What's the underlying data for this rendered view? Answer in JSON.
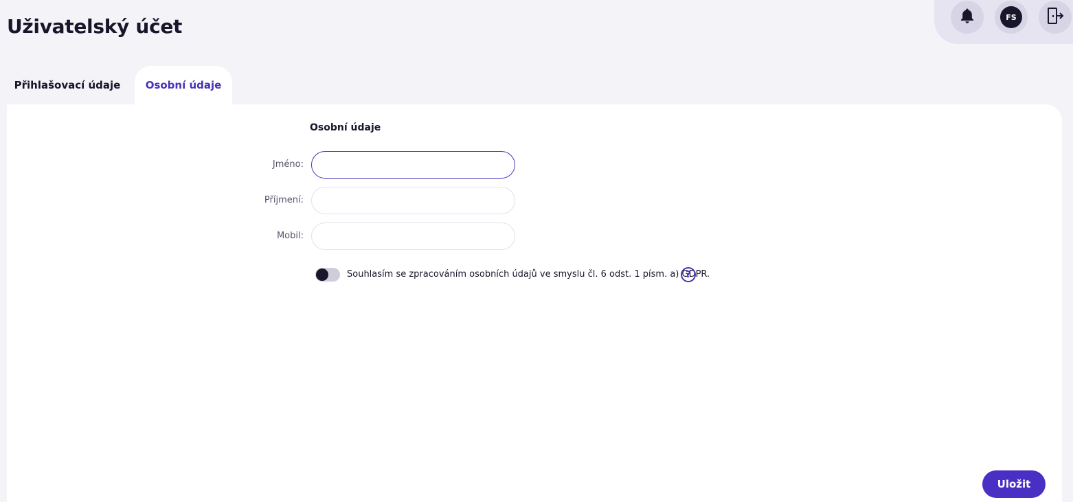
{
  "page": {
    "title": "Uživatelský účet"
  },
  "topbar": {
    "bell_icon": "bell-icon",
    "avatar_initials": "FS",
    "logout_icon": "logout-door-icon"
  },
  "tabs": [
    {
      "label": "Přihlašovací údaje",
      "active": false
    },
    {
      "label": "Osobní údaje",
      "active": true
    }
  ],
  "form": {
    "section_title": "Osobní údaje",
    "fields": [
      {
        "label": "Jméno:",
        "value": "",
        "placeholder": ""
      },
      {
        "label": "Příjmení:",
        "value": "",
        "placeholder": ""
      },
      {
        "label": "Mobil:",
        "value": "",
        "placeholder": ""
      }
    ],
    "consent": {
      "text": "Souhlasím se zpracováním osobních údajů ve smyslu čl. 6 odst. 1 písm. a) GDPR.",
      "checked": false
    },
    "help_glyph": "?"
  },
  "actions": {
    "save_label": "Uložit"
  },
  "colors": {
    "accent": "#4a32b8",
    "background": "#f4f3f8",
    "panel": "#ffffff"
  }
}
